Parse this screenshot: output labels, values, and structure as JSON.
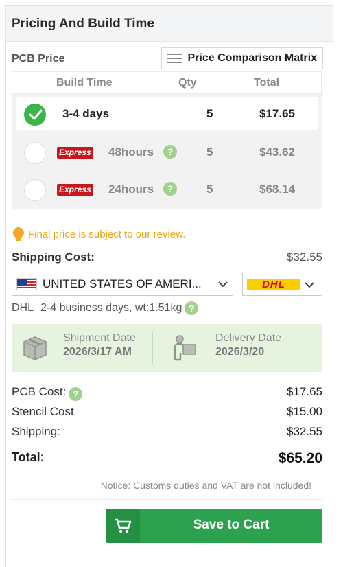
{
  "header": {
    "title": "Pricing And Build Time"
  },
  "pcb_price": {
    "label": "PCB Price",
    "compare_button": "Price Comparison Matrix"
  },
  "build_table": {
    "columns": {
      "build_time": "Build Time",
      "qty": "Qty",
      "total": "Total"
    },
    "rows": [
      {
        "time": "3-4 days",
        "express": false,
        "qty": "5",
        "total": "$17.65",
        "selected": true
      },
      {
        "badge": "Express",
        "time": "48hours",
        "express": true,
        "qty": "5",
        "total": "$43.62",
        "selected": false
      },
      {
        "badge": "Express",
        "time": "24hours",
        "express": true,
        "qty": "5",
        "total": "$68.14",
        "selected": false
      }
    ]
  },
  "review_notice": "Final price is subject to our review.",
  "shipping": {
    "label": "Shipping Cost:",
    "value": "$32.55",
    "country": "UNITED STATES OF AMERI...",
    "carrier_logo": "DHL",
    "info_carrier": "DHL",
    "info_text": "2-4 business days, wt:1.51kg"
  },
  "dates": {
    "shipment_label": "Shipment Date",
    "shipment_value": "2026/3/17 AM",
    "delivery_label": "Delivery Date",
    "delivery_value": "2026/3/20"
  },
  "costs": {
    "pcb_label": "PCB Cost:",
    "pcb_value": "$17.65",
    "stencil_label": "Stencil Cost",
    "stencil_value": "$15.00",
    "shipping_label": "Shipping:",
    "shipping_value": "$32.55",
    "total_label": "Total:",
    "total_value": "$65.20"
  },
  "customs_notice": "Notice: Customs duties and VAT are not included!",
  "save_button": "Save to Cart",
  "colors": {
    "accent_green": "#2ca14e",
    "express_red": "#c8161d",
    "notice_orange": "#e8a317",
    "dhl_yellow": "#ffcc00"
  }
}
